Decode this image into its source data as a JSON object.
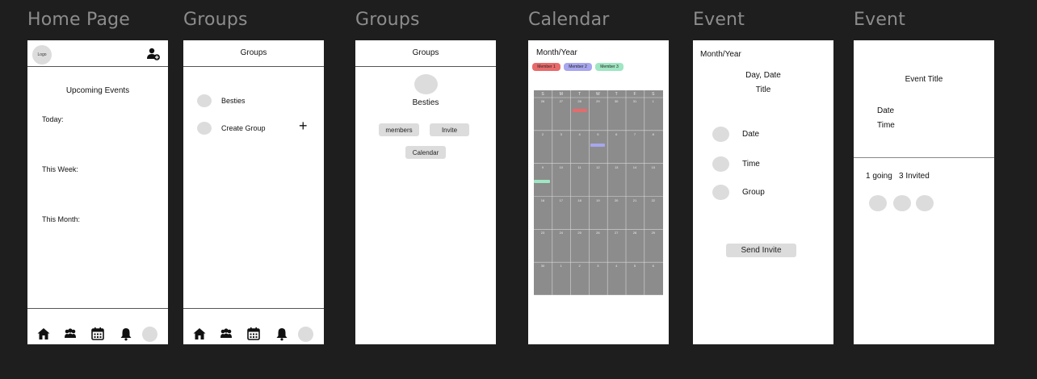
{
  "frames": [
    {
      "title": "Home Page"
    },
    {
      "title": "Groups"
    },
    {
      "title": "Groups"
    },
    {
      "title": "Calendar"
    },
    {
      "title": "Event"
    },
    {
      "title": "Event"
    }
  ],
  "home": {
    "logo": "Logo",
    "heading": "Upcoming Events",
    "today": "Today:",
    "this_week": "This Week:",
    "this_month": "This Month:"
  },
  "groups1": {
    "header": "Groups",
    "items": [
      {
        "label": "Besties"
      },
      {
        "label": "Create Group"
      }
    ],
    "add_symbol": "+"
  },
  "groups2": {
    "header": "Groups",
    "group_name": "Besties",
    "members_label": "members",
    "invite_label": "Invite",
    "calendar_label": "Calendar"
  },
  "calendar": {
    "month_year": "Month/Year",
    "members": [
      {
        "label": "Member 1",
        "color": "#e86a6a"
      },
      {
        "label": "Member 2",
        "color": "#a7a6ee"
      },
      {
        "label": "Member 3",
        "color": "#9fe6c2"
      }
    ],
    "weekdays": [
      "S",
      "M",
      "T",
      "W",
      "T",
      "F",
      "S"
    ],
    "weeks": [
      [
        "26",
        "27",
        "28",
        "29",
        "30",
        "31",
        "1"
      ],
      [
        "2",
        "3",
        "4",
        "5",
        "6",
        "7",
        "8"
      ],
      [
        "9",
        "10",
        "11",
        "12",
        "13",
        "14",
        "15"
      ],
      [
        "16",
        "17",
        "18",
        "19",
        "20",
        "21",
        "22"
      ],
      [
        "23",
        "24",
        "25",
        "26",
        "27",
        "28",
        "29"
      ],
      [
        "30",
        "1",
        "2",
        "3",
        "4",
        "5",
        "6"
      ]
    ]
  },
  "event1": {
    "month_year": "Month/Year",
    "day_date": "Day, Date",
    "title": "Title",
    "date": "Date",
    "time": "Time",
    "group": "Group",
    "send_invite": "Send Invite"
  },
  "event2": {
    "title": "Event Title",
    "date": "Date",
    "time": "Time",
    "going": "1 going",
    "invited": "3 Invited"
  }
}
